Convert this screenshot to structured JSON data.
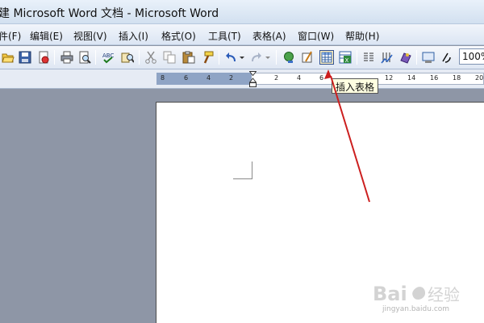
{
  "window": {
    "title": "建 Microsoft Word 文档 - Microsoft Word"
  },
  "menu": {
    "items": [
      {
        "label": "件(F)"
      },
      {
        "label": "编辑(E)"
      },
      {
        "label": "视图(V)"
      },
      {
        "label": "插入(I)"
      },
      {
        "label": "格式(O)"
      },
      {
        "label": "工具(T)"
      },
      {
        "label": "表格(A)"
      },
      {
        "label": "窗口(W)"
      },
      {
        "label": "帮助(H)"
      }
    ]
  },
  "toolbar": {
    "zoom": "100%",
    "buttons": [
      {
        "icon": "open-folder-icon"
      },
      {
        "icon": "save-icon"
      },
      {
        "icon": "permission-icon"
      },
      {
        "icon": "print-icon"
      },
      {
        "icon": "print-preview-icon"
      },
      {
        "icon": "spelling-icon"
      },
      {
        "icon": "research-icon"
      },
      {
        "icon": "cut-icon"
      },
      {
        "icon": "copy-icon"
      },
      {
        "icon": "paste-icon"
      },
      {
        "icon": "format-painter-icon"
      },
      {
        "icon": "undo-icon"
      },
      {
        "icon": "redo-icon"
      },
      {
        "icon": "hyperlink-icon"
      },
      {
        "icon": "tables-borders-icon"
      },
      {
        "icon": "insert-table-icon"
      },
      {
        "icon": "insert-excel-icon"
      },
      {
        "icon": "columns-icon"
      },
      {
        "icon": "drawing-icon"
      },
      {
        "icon": "document-map-icon"
      },
      {
        "icon": "reading-icon"
      },
      {
        "icon": "show-hide-icon"
      }
    ]
  },
  "tooltip": {
    "text": "插入表格"
  },
  "ruler": {
    "labels": [
      "8",
      "6",
      "4",
      "2",
      "2",
      "4",
      "6",
      "12",
      "14",
      "16",
      "18",
      "20"
    ]
  },
  "watermark": {
    "brand": "Baidu 经验",
    "url": "jingyan.baidu.com"
  },
  "colors": {
    "annotation_arrow": "#cc1f1f",
    "tooltip_bg": "#ffffe1",
    "highlight_bg": "#ffefbd"
  }
}
